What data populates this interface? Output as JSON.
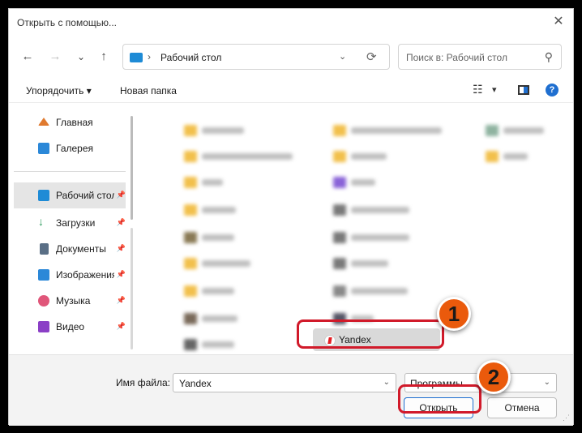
{
  "window": {
    "title": "Открыть с помощью..."
  },
  "nav": {
    "back": "←",
    "forward": "→",
    "recent": "⌄",
    "up": "↑",
    "address_path": "Рабочий стол",
    "refresh": "⟳"
  },
  "search": {
    "placeholder": "Поиск в: Рабочий стол"
  },
  "toolbar": {
    "organize": "Упорядочить ▾",
    "new_folder": "Новая папка",
    "view_icon": "☷",
    "view_dropdown": "▾",
    "help": "?"
  },
  "sidebar": {
    "items": [
      {
        "label": "Главная",
        "icon": "home-icon",
        "color": "#e07a2f"
      },
      {
        "label": "Галерея",
        "icon": "gallery-icon",
        "color": "#2b88d8"
      },
      {
        "label": "Рабочий стол",
        "icon": "desktop-icon",
        "color": "#1e8bd6",
        "pinned": true,
        "selected": true
      },
      {
        "label": "Загрузки",
        "icon": "downloads-icon",
        "color": "#2e9b5f",
        "pinned": true
      },
      {
        "label": "Документы",
        "icon": "documents-icon",
        "color": "#5a6f86",
        "pinned": true
      },
      {
        "label": "Изображения",
        "icon": "pictures-icon",
        "color": "#2b88d8",
        "pinned": true
      },
      {
        "label": "Музыка",
        "icon": "music-icon",
        "color": "#e0567a",
        "pinned": true
      },
      {
        "label": "Видео",
        "icon": "video-icon",
        "color": "#8b3fc6",
        "pinned": true
      }
    ]
  },
  "files": {
    "selected": {
      "name": "Yandex",
      "icon": "yandex-browser-icon"
    }
  },
  "annotations": {
    "badge1": "1",
    "badge2": "2"
  },
  "footer": {
    "filename_label": "Имя файла:",
    "filename_value": "Yandex",
    "filetype_value": "Программы",
    "open_button": "Открыть",
    "cancel_button": "Отмена"
  },
  "colors": {
    "accent": "#1f6fd0",
    "callout": "#d11a2a",
    "badge": "#ea5a0c",
    "folder": "#f2c04c"
  }
}
